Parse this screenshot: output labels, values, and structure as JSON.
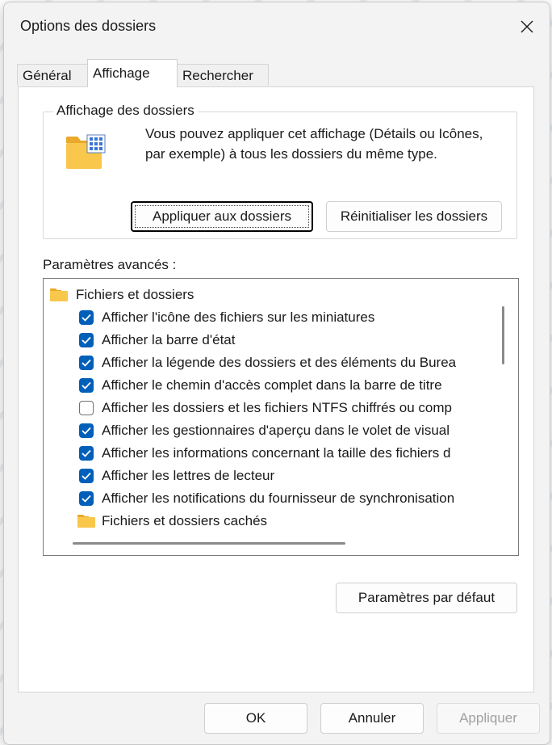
{
  "window": {
    "title": "Options des dossiers",
    "close_icon": "close-icon"
  },
  "tabs": [
    {
      "label": "Général",
      "active": false
    },
    {
      "label": "Affichage",
      "active": true
    },
    {
      "label": "Rechercher",
      "active": false
    }
  ],
  "folder_view": {
    "group_title": "Affichage des dossiers",
    "icon": "folder-grid-icon",
    "description": "Vous pouvez appliquer cet affichage (Détails ou Icônes, par exemple) à tous les dossiers du même type.",
    "apply_button": "Appliquer aux dossiers",
    "reset_button": "Réinitialiser les dossiers"
  },
  "advanced": {
    "label": "Paramètres avancés :",
    "items": [
      {
        "kind": "folder",
        "label": "Fichiers et dossiers"
      },
      {
        "kind": "checkbox",
        "checked": true,
        "label": "Afficher l'icône des fichiers sur les miniatures"
      },
      {
        "kind": "checkbox",
        "checked": true,
        "label": "Afficher la barre d'état"
      },
      {
        "kind": "checkbox",
        "checked": true,
        "label": "Afficher la légende des dossiers et des éléments du Burea"
      },
      {
        "kind": "checkbox",
        "checked": true,
        "label": "Afficher le chemin d'accès complet dans la barre de titre"
      },
      {
        "kind": "checkbox",
        "checked": false,
        "label": "Afficher les dossiers et les fichiers NTFS chiffrés ou comp"
      },
      {
        "kind": "checkbox",
        "checked": true,
        "label": "Afficher les gestionnaires d'aperçu dans le volet de visual"
      },
      {
        "kind": "checkbox",
        "checked": true,
        "label": "Afficher les informations concernant la taille des fichiers d"
      },
      {
        "kind": "checkbox",
        "checked": true,
        "label": "Afficher les lettres de lecteur"
      },
      {
        "kind": "checkbox",
        "checked": true,
        "label": "Afficher les notifications du fournisseur de synchronisation"
      },
      {
        "kind": "subfolder",
        "label": "Fichiers et dossiers cachés"
      }
    ],
    "defaults_button": "Paramètres par défaut"
  },
  "footer": {
    "ok": "OK",
    "cancel": "Annuler",
    "apply": "Appliquer"
  },
  "colors": {
    "accent": "#005fb8",
    "folder": "#f8c74b"
  }
}
